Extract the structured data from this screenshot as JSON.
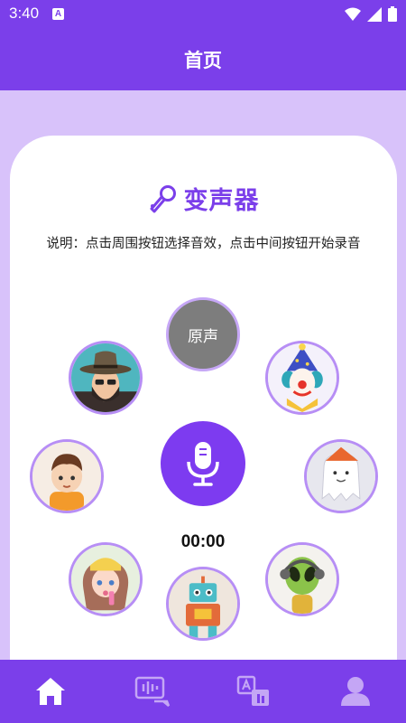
{
  "status": {
    "time": "3:40",
    "notification_letter": "A"
  },
  "header": {
    "title": "首页"
  },
  "main": {
    "app_title": "变声器",
    "description": "说明：点击周围按钮选择音效，点击中间按钮开始录音",
    "original_label": "原声",
    "timer": "00:00",
    "effects": [
      {
        "id": "uncle",
        "icon": "bearded-man-avatar-icon"
      },
      {
        "id": "clown",
        "icon": "clown-avatar-icon"
      },
      {
        "id": "child",
        "icon": "child-avatar-icon"
      },
      {
        "id": "ghost",
        "icon": "ghost-avatar-icon"
      },
      {
        "id": "girl",
        "icon": "girl-avatar-icon"
      },
      {
        "id": "robot",
        "icon": "robot-avatar-icon"
      },
      {
        "id": "alien",
        "icon": "alien-avatar-icon"
      }
    ]
  },
  "bottom_nav": {
    "active_color": "#ffffff",
    "inactive_color": "#c4a6f5",
    "items": [
      {
        "id": "home",
        "icon": "home-icon",
        "active": true
      },
      {
        "id": "voice",
        "icon": "voice-chat-icon",
        "active": false
      },
      {
        "id": "translate",
        "icon": "translate-icon",
        "active": false
      },
      {
        "id": "profile",
        "icon": "profile-icon",
        "active": false
      }
    ]
  },
  "colors": {
    "primary": "#7b3fea",
    "background": "#d8c2fa",
    "avatar_border": "#b78ef5",
    "original_button": "#7d7d7d"
  }
}
